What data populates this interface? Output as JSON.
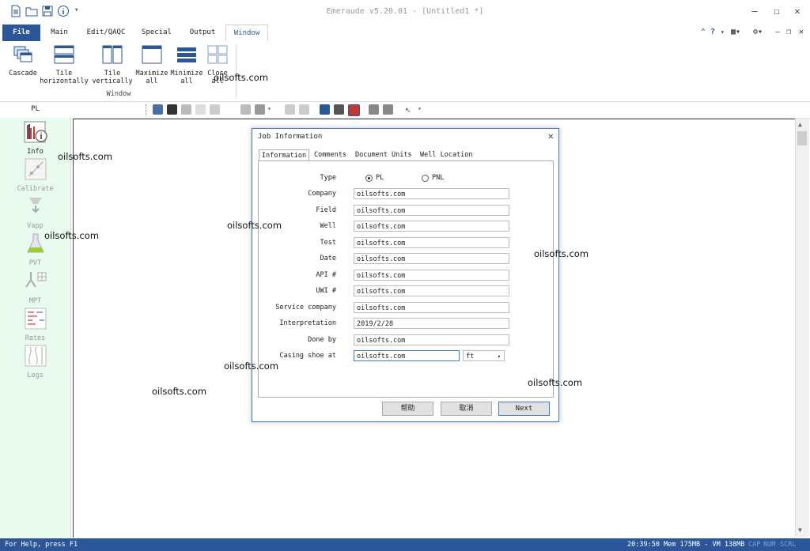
{
  "window": {
    "title": "Emeraude  v5.20.01 - [Untitled1 *]",
    "qat_icons": [
      "new-document-icon",
      "open-folder-icon",
      "save-icon",
      "info-icon",
      "dropdown-arrow-icon"
    ],
    "controls": {
      "minimize": "—",
      "maximize": "☐",
      "close": "✕"
    }
  },
  "ribbon": {
    "tabs": [
      {
        "label": "File"
      },
      {
        "label": "Main"
      },
      {
        "label": "Edit/QAQC"
      },
      {
        "label": "Special"
      },
      {
        "label": "Output"
      },
      {
        "label": "Window"
      }
    ],
    "right_tools": {
      "help": "?",
      "help_arrow": "▾",
      "layout": "▦▾",
      "tools": "⚙▾",
      "minimize": "–",
      "restore": "❐",
      "close": "✕"
    },
    "window_group": {
      "label": "Window",
      "buttons": [
        {
          "label": "Cascade"
        },
        {
          "label": "Tile horizontally"
        },
        {
          "label": "Tile vertically"
        },
        {
          "label": "Maximize all"
        },
        {
          "label": "Minimize all"
        },
        {
          "label": "Close all"
        }
      ]
    }
  },
  "panel_label": "PL",
  "sidebar": {
    "items": [
      {
        "label": "Info",
        "icon": "info-chart-icon"
      },
      {
        "label": "Calibrate",
        "icon": "calibrate-icon"
      },
      {
        "label": "Vapp",
        "icon": "vapp-icon"
      },
      {
        "label": "PVT",
        "icon": "flask-icon"
      },
      {
        "label": "MPT",
        "icon": "mpt-icon"
      },
      {
        "label": "Rates",
        "icon": "rates-icon"
      },
      {
        "label": "Logs",
        "icon": "logs-icon"
      }
    ]
  },
  "dialog": {
    "title": "Job Information",
    "close": "✕",
    "tabs": [
      "Information",
      "Comments",
      "Document Units",
      "Well Location"
    ],
    "type_label": "Type",
    "type_options": [
      {
        "label": "PL",
        "selected": true
      },
      {
        "label": "PNL",
        "selected": false
      }
    ],
    "fields": [
      {
        "label": "Company",
        "value": "oilsofts.com"
      },
      {
        "label": "Field",
        "value": "oilsofts.com"
      },
      {
        "label": "Well",
        "value": "oilsofts.com"
      },
      {
        "label": "Test",
        "value": "oilsofts.com"
      },
      {
        "label": "Date",
        "value": "oilsofts.com"
      },
      {
        "label": "API #",
        "value": "oilsofts.com"
      },
      {
        "label": "UWI #",
        "value": "oilsofts.com"
      },
      {
        "label": "Service company",
        "value": "oilsofts.com"
      },
      {
        "label": "Interpretation",
        "value": "2019/2/28"
      },
      {
        "label": "Done by",
        "value": "oilsofts.com"
      }
    ],
    "casing": {
      "label": "Casing shoe at",
      "value": "oilsofts.com",
      "unit": "ft",
      "unit_arrow": "▾"
    },
    "buttons": {
      "help": "帮助",
      "cancel": "取消",
      "next": "Next"
    }
  },
  "watermarks": [
    "oilsofts.com",
    "oilsofts.com",
    "oilsofts.com",
    "oilsofts.com",
    "oilsofts.com",
    "oilsofts.com",
    "oilsofts.com",
    "oilsofts.com"
  ],
  "status": {
    "left": "For Help, press F1",
    "right": "20:39:50 Mem 175MB - VM 138MB",
    "cap": "CAP",
    "num": "NUM",
    "scrl": "SCRL"
  },
  "colors": {
    "accent": "#2b579a",
    "sidebar_bg": "#e8fbee",
    "dialog_border": "#3c7fc4"
  }
}
